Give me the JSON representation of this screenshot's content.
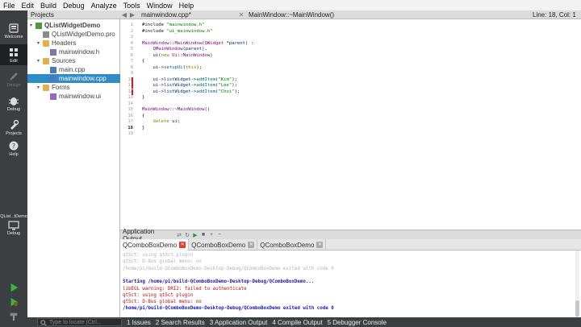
{
  "menu": [
    "File",
    "Edit",
    "Build",
    "Debug",
    "Analyze",
    "Tools",
    "Window",
    "Help"
  ],
  "modes": [
    {
      "label": "Welcome",
      "icon": "welcome-icon"
    },
    {
      "label": "Edit",
      "icon": "edit-icon"
    },
    {
      "label": "Design",
      "icon": "design-icon"
    },
    {
      "label": "Debug",
      "icon": "debug-icon"
    },
    {
      "label": "Projects",
      "icon": "projects-icon"
    },
    {
      "label": "Help",
      "icon": "help-icon"
    }
  ],
  "kit": {
    "project": "QList...tDemo",
    "label": "Debug"
  },
  "projects": {
    "title": "Projects",
    "tree": [
      {
        "label": "QListWidgetDemo",
        "level": 0,
        "kind": "project"
      },
      {
        "label": "QListWidgetDemo.pro",
        "level": 1,
        "kind": "pro"
      },
      {
        "label": "Headers",
        "level": 1,
        "kind": "folder"
      },
      {
        "label": "mainwindow.h",
        "level": 2,
        "kind": "h"
      },
      {
        "label": "Sources",
        "level": 1,
        "kind": "folder"
      },
      {
        "label": "main.cpp",
        "level": 2,
        "kind": "cpp"
      },
      {
        "label": "mainwindow.cpp",
        "level": 2,
        "kind": "cpp",
        "selected": true
      },
      {
        "label": "Forms",
        "level": 1,
        "kind": "folder"
      },
      {
        "label": "mainwindow.ui",
        "level": 2,
        "kind": "ui"
      }
    ]
  },
  "editor": {
    "file": "mainwindow.cpp*",
    "function": "MainWindow::~MainWindow()",
    "position": "Line: 18, Col: 1",
    "current_line": 18,
    "modified_lines": [
      10,
      11,
      12
    ],
    "lines": [
      "#include \"mainwindow.h\"",
      "#include \"ui_mainwindow.h\"",
      "",
      "MainWindow::MainWindow(QWidget *parent) :",
      "    QMainWindow(parent),",
      "    ui(new Ui::MainWindow)",
      "{",
      "    ui->setupUi(this);",
      "",
      "    ui->listWidget->addItem(\"Kim\");",
      "    ui->listWidget->addItem(\"Lee\");",
      "    ui->listWidget->addItem(\"Choi\");",
      "}",
      "",
      "MainWindow::~MainWindow()",
      "{",
      "    delete ui;",
      "}",
      ""
    ]
  },
  "output": {
    "title": "Application Output",
    "tabs": [
      "QComboBoxDemo",
      "QComboBoxDemo",
      "QComboBoxDemo"
    ],
    "lines": [
      {
        "text": "qt5ct: using qt5ct plugin",
        "style": "dim"
      },
      {
        "text": "qt5ct: D-Bus global menu: no",
        "style": "dim"
      },
      {
        "text": "/home/pi/build-QComboBoxDemo-Desktop-Debug/QComboBoxDemo exited with code 0",
        "style": "dim"
      },
      {
        "text": "",
        "style": "dim"
      },
      {
        "text": "Starting /home/pi/build-QComboBoxDemo-Desktop-Debug/QComboBoxDemo...",
        "style": "blue"
      },
      {
        "text": "libEGL warning: DRI2: failed to authenticate",
        "style": "red"
      },
      {
        "text": "qt5ct: using qt5ct plugin",
        "style": "red"
      },
      {
        "text": "qt5ct: D-Bus global menu: no",
        "style": "red"
      },
      {
        "text": "/home/pi/build-QComboBoxDemo-Desktop-Debug/QComboBoxDemo exited with code 0",
        "style": "blue"
      }
    ]
  },
  "status": {
    "locator_placeholder": "Type to locate (Ctrl...",
    "panes": [
      "1 Issues",
      "2 Search Results",
      "3 Application Output",
      "4 Compile Output",
      "5 Debugger Console"
    ]
  }
}
